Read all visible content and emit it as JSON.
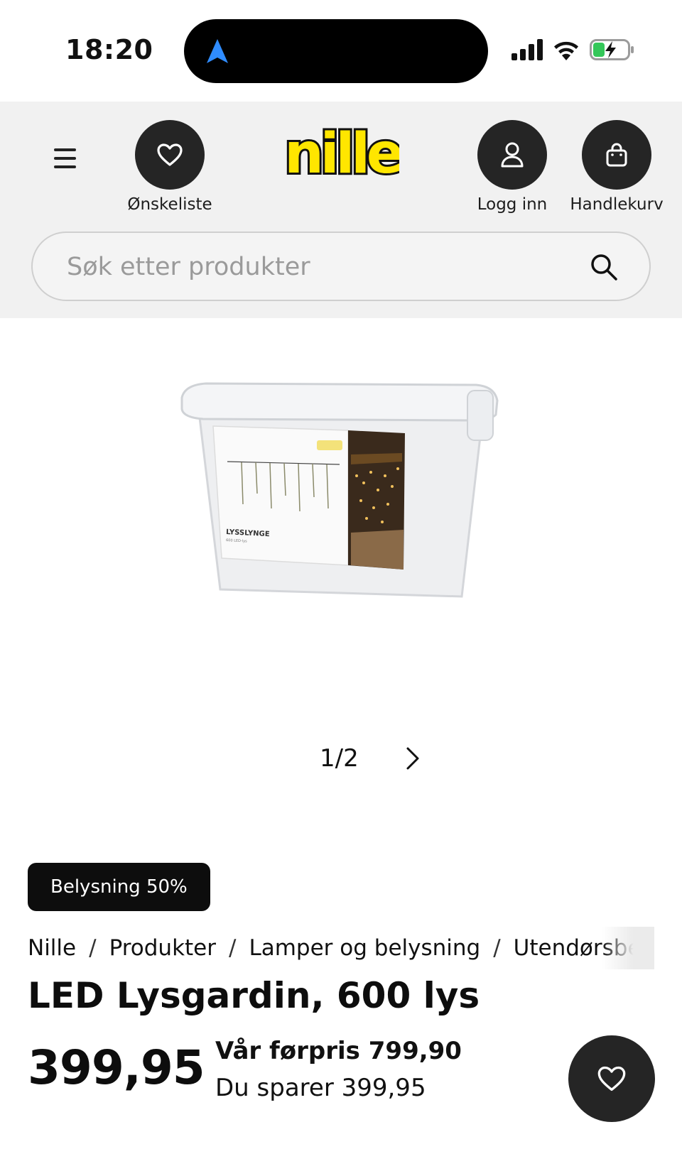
{
  "status_bar": {
    "time": "18:20"
  },
  "header": {
    "menu_icon": "hamburger-menu-icon",
    "wishlist_label": "Ønskeliste",
    "logo_text": "nille",
    "login_label": "Logg inn",
    "cart_label": "Handlekurv"
  },
  "search": {
    "placeholder": "Søk etter produkter"
  },
  "gallery": {
    "pager": "1/2",
    "box_label": "LYSSLYNGE",
    "box_sublabel": "600 LED-lys"
  },
  "product": {
    "badge": "Belysning 50%",
    "breadcrumb": [
      "Nille",
      "Produkter",
      "Lamper og belysning",
      "Utendørsbe"
    ],
    "title": "LED Lysgardin, 600 lys",
    "price": "399,95",
    "previous_price": "Vår førpris 799,90",
    "savings": "Du sparer 399,95"
  },
  "colors": {
    "logo_yellow": "#ffe600",
    "dark_circle": "#252525",
    "header_bg": "#f1f1f1"
  }
}
